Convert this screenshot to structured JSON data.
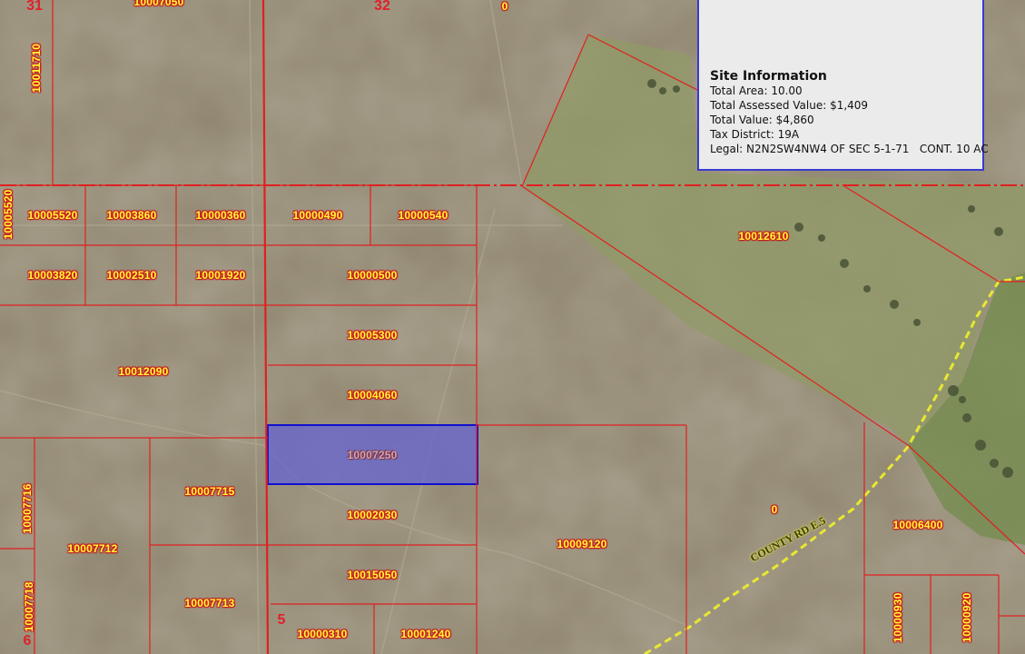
{
  "site_info": {
    "title": "Site Information",
    "total_area": "Total Area: 10.00",
    "total_assessed_value": "Total Assessed Value: $1,409",
    "total_value": "Total Value: $4,860",
    "tax_district": "Tax District: 19A",
    "legal": "Legal: N2N2SW4NW4 OF SEC 5-1-71   CONT. 10 AC"
  },
  "sections": {
    "s31": "31",
    "s32": "32",
    "s5": "5",
    "s6": "6"
  },
  "road_label": "COUNTY RD E.5",
  "parcels": {
    "p10007050": "10007050",
    "p10011710": "10011710",
    "p0_top": "0",
    "p10005520_v": "10005520",
    "p10005520": "10005520",
    "p10003860": "10003860",
    "p10000360": "10000360",
    "p10000490": "10000490",
    "p10000540": "10000540",
    "p10012610": "10012610",
    "p10003820": "10003820",
    "p10002510": "10002510",
    "p10001920": "10001920",
    "p10000500": "10000500",
    "p10005300": "10005300",
    "p10012090": "10012090",
    "p10004060": "10004060",
    "p10007250": "10007250",
    "p10007716": "10007716",
    "p10007715": "10007715",
    "p10002030": "10002030",
    "p0_mid": "0",
    "p10006400": "10006400",
    "p10007712": "10007712",
    "p10009120": "10009120",
    "p10015050": "10015050",
    "p10007718": "10007718",
    "p10007713": "10007713",
    "p10000310": "10000310",
    "p10001240": "10001240",
    "p10000930": "10000930",
    "p10000920": "10000920"
  },
  "colors": {
    "terrain": "#8a8069",
    "green_field": "#8a9560",
    "parcel_line": "#e02020",
    "selected_fill": "#6464d2",
    "selected_border": "#1010d0",
    "road": "#e8e830",
    "label_text": "#fffb3a"
  },
  "icons": {}
}
